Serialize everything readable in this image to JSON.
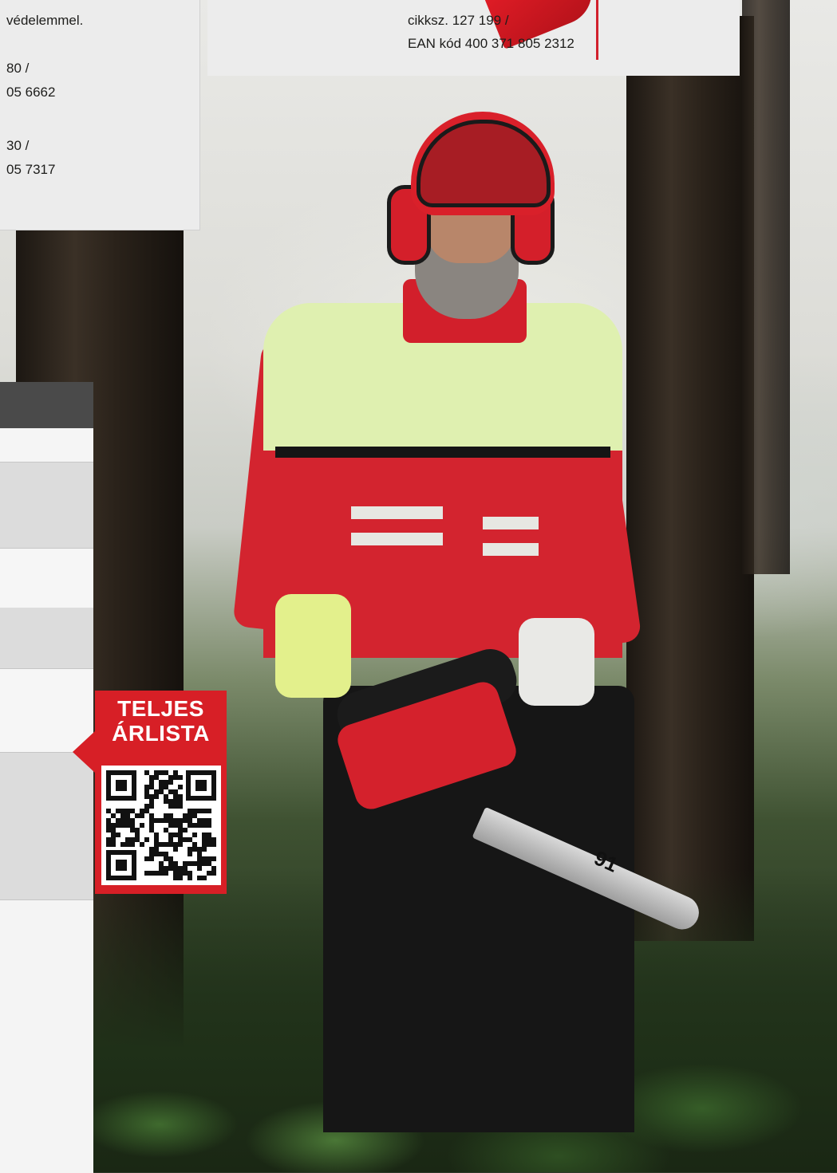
{
  "left_box": {
    "lines": [
      "védelemmel.",
      "80 /",
      "05 6662",
      "30 /",
      "05 7317"
    ]
  },
  "center_box": {
    "lines": [
      "cikksz. 127 199 /",
      "EAN kód 400 371 805 2312"
    ]
  },
  "callout": {
    "line1": "TELJES",
    "line2": "ÁRLISTA",
    "qr_icon": "qr-code-icon"
  },
  "photo": {
    "bar_marking": "91"
  },
  "colors": {
    "brand_red": "#d71f26",
    "panel_gray": "#ececec",
    "text_dark": "#1d1d1b"
  }
}
